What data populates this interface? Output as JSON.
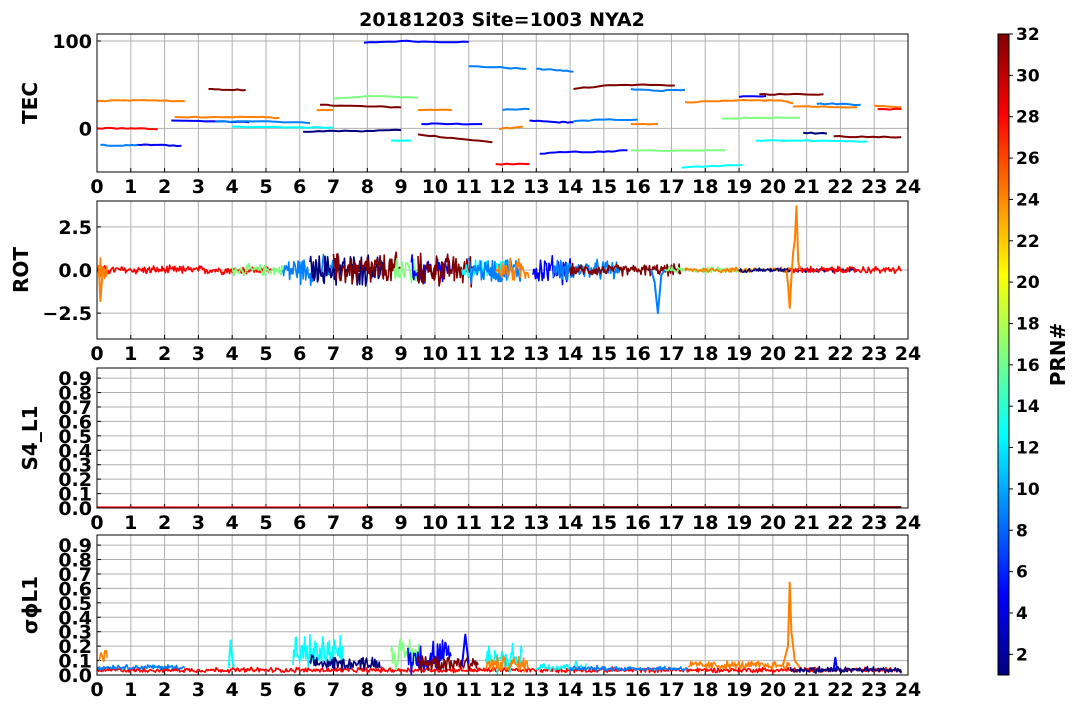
{
  "figure_title": "20181203 Site=1003 NYA2",
  "colorbar": {
    "label": "PRN#",
    "ticks": [
      2,
      4,
      6,
      8,
      10,
      12,
      14,
      16,
      18,
      20,
      22,
      24,
      26,
      28,
      30,
      32
    ],
    "range": [
      1,
      32
    ],
    "colormap": "jet",
    "colors": [
      "#00007f",
      "#0000ff",
      "#007fff",
      "#00ffff",
      "#7fff7f",
      "#ffff00",
      "#ff7f00",
      "#ff0000",
      "#7f0000"
    ]
  },
  "chart_data": [
    {
      "type": "line",
      "ylabel": "TEC",
      "xlim": [
        0,
        24
      ],
      "ylim": [
        -50,
        108
      ],
      "yticks": [
        "0",
        "100"
      ],
      "ytick_values": [
        0,
        100
      ],
      "xticks": [
        "0",
        "1",
        "2",
        "3",
        "4",
        "5",
        "6",
        "7",
        "8",
        "9",
        "10",
        "11",
        "12",
        "13",
        "14",
        "15",
        "16",
        "17",
        "18",
        "19",
        "20",
        "21",
        "22",
        "23",
        "24"
      ],
      "grid": true,
      "series": [
        {
          "color": "#ff7f00",
          "x": [
            0,
            0.7,
            1.5,
            2.6
          ],
          "y": [
            31,
            32,
            32,
            31
          ]
        },
        {
          "color": "#ff0000",
          "x": [
            0,
            0.5,
            1.0,
            1.8
          ],
          "y": [
            0,
            0,
            0,
            -1
          ]
        },
        {
          "color": "#007fff",
          "x": [
            0.1,
            0.7,
            1.2
          ],
          "y": [
            -19,
            -20,
            -19
          ]
        },
        {
          "color": "#0000ff",
          "x": [
            1.2,
            1.8,
            2.5
          ],
          "y": [
            -19,
            -19,
            -20
          ]
        },
        {
          "color": "#7f0000",
          "x": [
            3.3,
            3.9,
            4.4
          ],
          "y": [
            45,
            44,
            44
          ]
        },
        {
          "color": "#ff7f00",
          "x": [
            2.3,
            3.5,
            4.6,
            5.4
          ],
          "y": [
            13,
            13,
            13,
            12
          ]
        },
        {
          "color": "#0000ff",
          "x": [
            2.2,
            3.4,
            4.5
          ],
          "y": [
            9,
            8,
            7
          ]
        },
        {
          "color": "#007fff",
          "x": [
            3.5,
            4.8,
            6.3
          ],
          "y": [
            8,
            8,
            6
          ]
        },
        {
          "color": "#00ffff",
          "x": [
            4.0,
            5.5,
            7.0
          ],
          "y": [
            2,
            1,
            1
          ]
        },
        {
          "color": "#00007f",
          "x": [
            6.1,
            7.0,
            8.0,
            9.0
          ],
          "y": [
            -4,
            -3,
            -3,
            -2
          ]
        },
        {
          "color": "#7f0000",
          "x": [
            6.6,
            7.2,
            8.1,
            9.0
          ],
          "y": [
            27,
            26,
            25,
            24
          ]
        },
        {
          "color": "#ff7f00",
          "x": [
            6.5,
            7.0
          ],
          "y": [
            21,
            21
          ]
        },
        {
          "color": "#7fff7f",
          "x": [
            7.0,
            8.0,
            9.5
          ],
          "y": [
            34,
            37,
            35
          ]
        },
        {
          "color": "#0000ff",
          "x": [
            7.9,
            9.0,
            10.0,
            11.0
          ],
          "y": [
            98,
            100,
            99,
            99
          ]
        },
        {
          "color": "#007fff",
          "x": [
            11.0,
            11.8,
            12.7
          ],
          "y": [
            71,
            70,
            68
          ]
        },
        {
          "color": "#007fff",
          "x": [
            13.0,
            13.5,
            14.1
          ],
          "y": [
            68,
            67,
            65
          ]
        },
        {
          "color": "#ff7f00",
          "x": [
            9.5,
            10.5
          ],
          "y": [
            21,
            21
          ]
        },
        {
          "color": "#7f0000",
          "x": [
            9.5,
            10.5,
            11.7
          ],
          "y": [
            -7,
            -11,
            -16
          ]
        },
        {
          "color": "#00ffff",
          "x": [
            8.7,
            9.3
          ],
          "y": [
            -14,
            -14
          ]
        },
        {
          "color": "#0000ff",
          "x": [
            9.6,
            10.5,
            11.4
          ],
          "y": [
            5,
            5,
            5
          ]
        },
        {
          "color": "#ff7f00",
          "x": [
            11.9,
            12.6
          ],
          "y": [
            -1,
            2
          ]
        },
        {
          "color": "#ff0000",
          "x": [
            11.8,
            12.8
          ],
          "y": [
            -41,
            -41
          ]
        },
        {
          "color": "#007fff",
          "x": [
            12.0,
            12.8
          ],
          "y": [
            21,
            22
          ]
        },
        {
          "color": "#0000ff",
          "x": [
            12.8,
            13.6,
            14.1
          ],
          "y": [
            9,
            7,
            7
          ]
        },
        {
          "color": "#0000ff",
          "x": [
            13.1,
            14.0,
            15.0,
            15.7
          ],
          "y": [
            -29,
            -27,
            -27,
            -25
          ]
        },
        {
          "color": "#007fff",
          "x": [
            14.1,
            15.0,
            16.0
          ],
          "y": [
            8,
            10,
            10
          ]
        },
        {
          "color": "#ff7f00",
          "x": [
            15.8,
            16.6
          ],
          "y": [
            5,
            5
          ]
        },
        {
          "color": "#7f0000",
          "x": [
            14.1,
            15.0,
            16.0,
            17.1
          ],
          "y": [
            45,
            49,
            50,
            49
          ]
        },
        {
          "color": "#007fff",
          "x": [
            15.8,
            16.6,
            17.4
          ],
          "y": [
            45,
            43,
            44
          ]
        },
        {
          "color": "#7fff7f",
          "x": [
            15.8,
            17.0,
            18.6
          ],
          "y": [
            -25,
            -26,
            -25
          ]
        },
        {
          "color": "#00ffff",
          "x": [
            17.3,
            18.2,
            19.1
          ],
          "y": [
            -45,
            -43,
            -42
          ]
        },
        {
          "color": "#ff7f00",
          "x": [
            17.4,
            18.4,
            19.3,
            20.2,
            20.6
          ],
          "y": [
            30,
            31,
            32,
            32,
            29
          ]
        },
        {
          "color": "#7fff7f",
          "x": [
            18.5,
            19.5,
            20.8
          ],
          "y": [
            11,
            12,
            12
          ]
        },
        {
          "color": "#0000ff",
          "x": [
            19.0,
            19.8
          ],
          "y": [
            36,
            37
          ]
        },
        {
          "color": "#7f0000",
          "x": [
            19.6,
            20.5,
            21.5
          ],
          "y": [
            39,
            39,
            39
          ]
        },
        {
          "color": "#ff7f00",
          "x": [
            20.6,
            21.5,
            22.5
          ],
          "y": [
            25,
            25,
            24
          ]
        },
        {
          "color": "#007fff",
          "x": [
            21.3,
            22.0,
            22.6
          ],
          "y": [
            28,
            28,
            27
          ]
        },
        {
          "color": "#00ffff",
          "x": [
            19.5,
            20.5,
            21.5,
            22.8
          ],
          "y": [
            -14,
            -14,
            -14,
            -15
          ]
        },
        {
          "color": "#00007f",
          "x": [
            20.9,
            21.6
          ],
          "y": [
            -5,
            -6
          ]
        },
        {
          "color": "#7f0000",
          "x": [
            21.8,
            22.8,
            23.8
          ],
          "y": [
            -9,
            -10,
            -10
          ]
        },
        {
          "color": "#ff7f00",
          "x": [
            23.0,
            23.8
          ],
          "y": [
            26,
            24
          ]
        },
        {
          "color": "#ff0000",
          "x": [
            23.1,
            23.8
          ],
          "y": [
            22,
            22
          ]
        }
      ]
    },
    {
      "type": "line",
      "ylabel": "ROT",
      "xlim": [
        0,
        24
      ],
      "ylim": [
        -4,
        4
      ],
      "yticks": [
        "−2.5",
        "0.0",
        "2.5"
      ],
      "ytick_values": [
        -2.5,
        0,
        2.5
      ],
      "xticks": [
        "0",
        "1",
        "2",
        "3",
        "4",
        "5",
        "6",
        "7",
        "8",
        "9",
        "10",
        "11",
        "12",
        "13",
        "14",
        "15",
        "16",
        "17",
        "18",
        "19",
        "20",
        "21",
        "22",
        "23",
        "24"
      ],
      "grid": true,
      "noise_segments": [
        {
          "color": "#ff0000",
          "x0": 0.0,
          "x1": 2.5,
          "amp": 0.3
        },
        {
          "color": "#ff7f00",
          "x0": 0.05,
          "x1": 0.3,
          "amp": 0.9
        },
        {
          "color": "#ff0000",
          "x0": 2.5,
          "x1": 5.2,
          "amp": 0.3
        },
        {
          "color": "#7fff7f",
          "x0": 4.0,
          "x1": 5.5,
          "amp": 0.4
        },
        {
          "color": "#007fff",
          "x0": 5.5,
          "x1": 7.3,
          "amp": 1.0
        },
        {
          "color": "#00007f",
          "x0": 6.3,
          "x1": 8.5,
          "amp": 1.1
        },
        {
          "color": "#7f0000",
          "x0": 7.0,
          "x1": 9.0,
          "amp": 1.2
        },
        {
          "color": "#7fff7f",
          "x0": 8.8,
          "x1": 9.6,
          "amp": 1.3
        },
        {
          "color": "#0000ff",
          "x0": 9.3,
          "x1": 10.5,
          "amp": 1.0
        },
        {
          "color": "#7f0000",
          "x0": 9.5,
          "x1": 11.2,
          "amp": 1.1
        },
        {
          "color": "#00ffff",
          "x0": 10.8,
          "x1": 12.2,
          "amp": 0.7
        },
        {
          "color": "#007fff",
          "x0": 11.0,
          "x1": 12.6,
          "amp": 0.9
        },
        {
          "color": "#ff7f00",
          "x0": 11.8,
          "x1": 12.8,
          "amp": 0.8
        },
        {
          "color": "#0000ff",
          "x0": 12.9,
          "x1": 14.1,
          "amp": 1.0
        },
        {
          "color": "#007fff",
          "x0": 13.5,
          "x1": 15.5,
          "amp": 0.7
        },
        {
          "color": "#7f0000",
          "x0": 14.0,
          "x1": 17.3,
          "amp": 0.4
        },
        {
          "color": "#7fff7f",
          "x0": 16.8,
          "x1": 19.0,
          "amp": 0.2
        },
        {
          "color": "#ff7f00",
          "x0": 17.4,
          "x1": 20.5,
          "amp": 0.2
        },
        {
          "color": "#00007f",
          "x0": 19.0,
          "x1": 22.5,
          "amp": 0.15
        },
        {
          "color": "#ff0000",
          "x0": 20.5,
          "x1": 23.8,
          "amp": 0.25
        }
      ],
      "spikes": [
        {
          "color": "#ff7f00",
          "x": [
            20.4,
            20.45,
            20.5,
            20.55,
            20.6,
            20.65,
            20.7,
            20.75,
            20.8
          ],
          "y": [
            0,
            -0.8,
            -2.2,
            -0.5,
            1.0,
            1.7,
            3.7,
            0.5,
            0
          ]
        },
        {
          "color": "#007fff",
          "x": [
            16.4,
            16.5,
            16.6,
            16.7,
            16.8
          ],
          "y": [
            0,
            -0.7,
            -2.5,
            -0.3,
            0
          ]
        },
        {
          "color": "#ff7f00",
          "x": [
            0.05,
            0.1,
            0.15,
            0.2
          ],
          "y": [
            0.3,
            -1.8,
            -0.5,
            0.1
          ]
        }
      ]
    },
    {
      "type": "line",
      "ylabel": "S4_L1",
      "xlim": [
        0,
        24
      ],
      "ylim": [
        0,
        0.97
      ],
      "yticks": [
        "0.0",
        "0.1",
        "0.2",
        "0.3",
        "0.4",
        "0.5",
        "0.6",
        "0.7",
        "0.8",
        "0.9"
      ],
      "ytick_values": [
        0,
        0.1,
        0.2,
        0.3,
        0.4,
        0.5,
        0.6,
        0.7,
        0.8,
        0.9
      ],
      "xticks": [
        "0",
        "1",
        "2",
        "3",
        "4",
        "5",
        "6",
        "7",
        "8",
        "9",
        "10",
        "11",
        "12",
        "13",
        "14",
        "15",
        "16",
        "17",
        "18",
        "19",
        "20",
        "21",
        "22",
        "23",
        "24"
      ],
      "grid": true,
      "flat_series": [
        {
          "color": "#ff0000",
          "x0": 0,
          "x1": 23.8,
          "y": 0.003
        },
        {
          "color": "#7f0000",
          "x0": 8,
          "x1": 23.8,
          "y": 0.004
        }
      ]
    },
    {
      "type": "line",
      "ylabel": "σϕL1",
      "xlim": [
        0,
        24
      ],
      "ylim": [
        0,
        0.97
      ],
      "yticks": [
        "0.0",
        "0.1",
        "0.2",
        "0.3",
        "0.4",
        "0.5",
        "0.6",
        "0.7",
        "0.8",
        "0.9"
      ],
      "ytick_values": [
        0,
        0.1,
        0.2,
        0.3,
        0.4,
        0.5,
        0.6,
        0.7,
        0.8,
        0.9
      ],
      "xticks": [
        "0",
        "1",
        "2",
        "3",
        "4",
        "5",
        "6",
        "7",
        "8",
        "9",
        "10",
        "11",
        "12",
        "13",
        "14",
        "15",
        "16",
        "17",
        "18",
        "19",
        "20",
        "21",
        "22",
        "23",
        "24"
      ],
      "grid": true,
      "noise_segments": [
        {
          "color": "#ff0000",
          "x0": 0.0,
          "x1": 23.8,
          "base": 0.03,
          "amp": 0.03
        },
        {
          "color": "#007fff",
          "x0": 0.0,
          "x1": 2.6,
          "base": 0.05,
          "amp": 0.03
        },
        {
          "color": "#ff7f00",
          "x0": 0.05,
          "x1": 0.3,
          "base": 0.12,
          "amp": 0.1
        },
        {
          "color": "#00ffff",
          "x0": 5.8,
          "x1": 7.3,
          "base": 0.12,
          "amp": 0.2
        },
        {
          "color": "#00007f",
          "x0": 6.3,
          "x1": 8.4,
          "base": 0.07,
          "amp": 0.08
        },
        {
          "color": "#7fff7f",
          "x0": 8.7,
          "x1": 9.6,
          "base": 0.12,
          "amp": 0.18
        },
        {
          "color": "#0000ff",
          "x0": 9.2,
          "x1": 10.5,
          "base": 0.1,
          "amp": 0.2
        },
        {
          "color": "#7f0000",
          "x0": 9.5,
          "x1": 11.3,
          "base": 0.07,
          "amp": 0.12
        },
        {
          "color": "#00ffff",
          "x0": 11.5,
          "x1": 12.6,
          "base": 0.08,
          "amp": 0.18
        },
        {
          "color": "#ff7f00",
          "x0": 11.5,
          "x1": 12.8,
          "base": 0.06,
          "amp": 0.1
        },
        {
          "color": "#00ffff",
          "x0": 13.0,
          "x1": 14.5,
          "base": 0.05,
          "amp": 0.06
        },
        {
          "color": "#007fff",
          "x0": 14.0,
          "x1": 17.5,
          "base": 0.04,
          "amp": 0.03
        },
        {
          "color": "#ff7f00",
          "x0": 17.5,
          "x1": 20.5,
          "base": 0.06,
          "amp": 0.05
        },
        {
          "color": "#00007f",
          "x0": 20.5,
          "x1": 23.8,
          "base": 0.03,
          "amp": 0.04
        }
      ],
      "spikes": [
        {
          "color": "#ff7f00",
          "x": [
            20.3,
            20.45,
            20.5,
            20.55,
            20.65,
            20.8
          ],
          "y": [
            0.07,
            0.2,
            0.64,
            0.3,
            0.1,
            0.05
          ]
        },
        {
          "color": "#00ffff",
          "x": [
            3.9,
            3.95,
            4.0,
            4.05
          ],
          "y": [
            0.05,
            0.24,
            0.12,
            0.05
          ]
        },
        {
          "color": "#0000ff",
          "x": [
            10.8,
            10.9,
            11.0
          ],
          "y": [
            0.06,
            0.28,
            0.08
          ]
        },
        {
          "color": "#0000ff",
          "x": [
            21.8,
            21.85,
            21.9
          ],
          "y": [
            0.04,
            0.12,
            0.04
          ]
        }
      ]
    }
  ]
}
